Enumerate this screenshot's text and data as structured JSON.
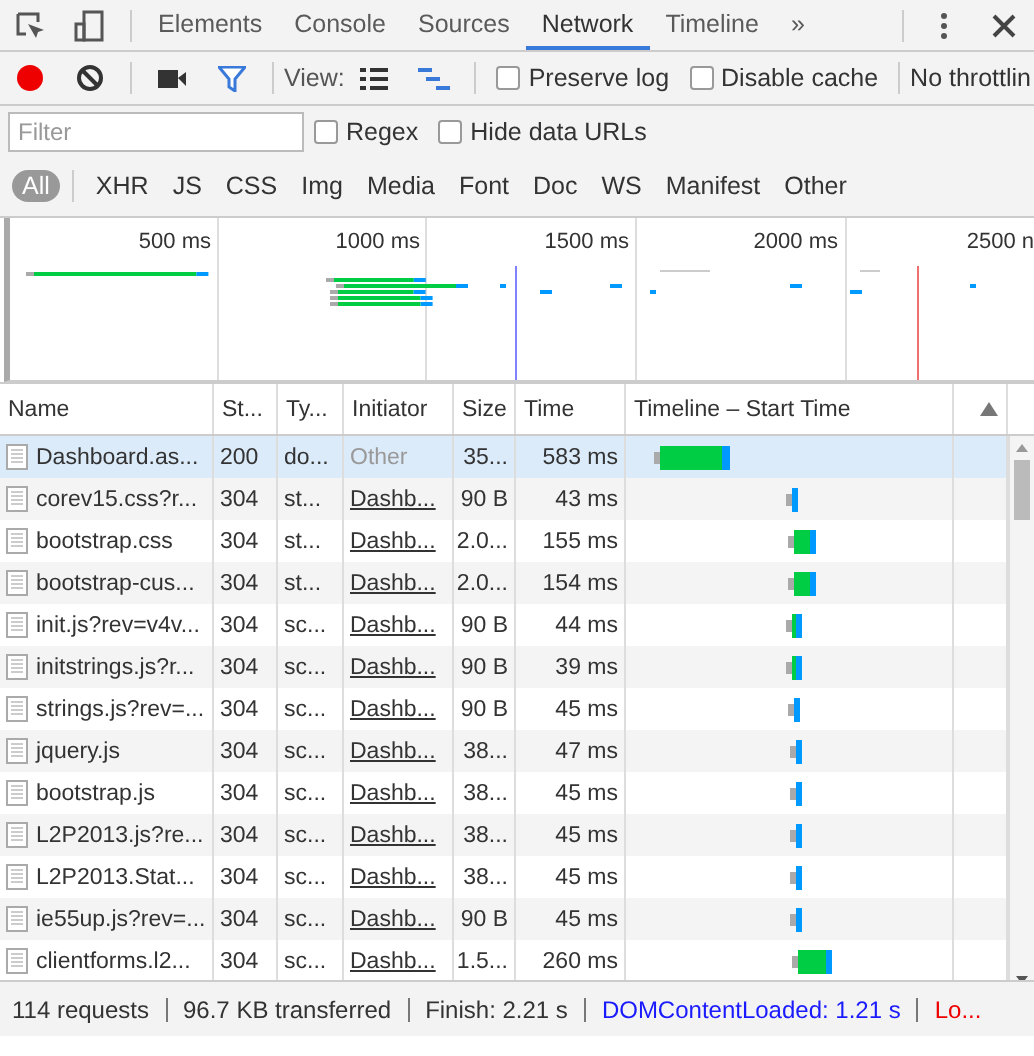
{
  "panel_tabs": [
    {
      "label": "Elements",
      "selected": false
    },
    {
      "label": "Console",
      "selected": false
    },
    {
      "label": "Sources",
      "selected": false
    },
    {
      "label": "Network",
      "selected": true
    },
    {
      "label": "Timeline",
      "selected": false
    }
  ],
  "more_tabs": "»",
  "toolbar": {
    "recording": true,
    "filter_shown": true,
    "view_label": "View:",
    "large_rows": false,
    "overview": true,
    "preserve_log": {
      "label": "Preserve log",
      "checked": false
    },
    "disable_cache": {
      "label": "Disable cache",
      "checked": false
    },
    "throttling": "No throttlin"
  },
  "filter_bar": {
    "placeholder": "Filter",
    "regex": {
      "label": "Regex",
      "checked": false
    },
    "hide_data_urls": {
      "label": "Hide data URLs",
      "checked": false
    }
  },
  "type_filters": [
    {
      "label": "All",
      "selected": true
    },
    {
      "label": "XHR",
      "selected": false
    },
    {
      "label": "JS",
      "selected": false
    },
    {
      "label": "CSS",
      "selected": false
    },
    {
      "label": "Img",
      "selected": false
    },
    {
      "label": "Media",
      "selected": false
    },
    {
      "label": "Font",
      "selected": false
    },
    {
      "label": "Doc",
      "selected": false
    },
    {
      "label": "WS",
      "selected": false
    },
    {
      "label": "Manifest",
      "selected": false
    },
    {
      "label": "Other",
      "selected": false
    }
  ],
  "overview": {
    "ticks": [
      "500 ms",
      "1000 ms",
      "1500 ms",
      "2000 ms",
      "2500 n"
    ]
  },
  "table": {
    "columns": [
      "Name",
      "St...",
      "Ty...",
      "Initiator",
      "Size",
      "Time",
      "Timeline – Start Time"
    ],
    "rows": [
      {
        "name": "Dashboard.as...",
        "status": "200",
        "type": "do...",
        "initiator": "Other",
        "initiator_link": false,
        "size": "35...",
        "time": "583 ms",
        "selected": true
      },
      {
        "name": "corev15.css?r...",
        "status": "304",
        "type": "st...",
        "initiator": "Dashb...",
        "initiator_link": true,
        "size": "90 B",
        "time": "43 ms",
        "selected": false
      },
      {
        "name": "bootstrap.css",
        "status": "304",
        "type": "st...",
        "initiator": "Dashb...",
        "initiator_link": true,
        "size": "2.0...",
        "time": "155 ms",
        "selected": false
      },
      {
        "name": "bootstrap-cus...",
        "status": "304",
        "type": "st...",
        "initiator": "Dashb...",
        "initiator_link": true,
        "size": "2.0...",
        "time": "154 ms",
        "selected": false
      },
      {
        "name": "init.js?rev=v4v...",
        "status": "304",
        "type": "sc...",
        "initiator": "Dashb...",
        "initiator_link": true,
        "size": "90 B",
        "time": "44 ms",
        "selected": false
      },
      {
        "name": "initstrings.js?r...",
        "status": "304",
        "type": "sc...",
        "initiator": "Dashb...",
        "initiator_link": true,
        "size": "90 B",
        "time": "39 ms",
        "selected": false
      },
      {
        "name": "strings.js?rev=...",
        "status": "304",
        "type": "sc...",
        "initiator": "Dashb...",
        "initiator_link": true,
        "size": "90 B",
        "time": "45 ms",
        "selected": false
      },
      {
        "name": "jquery.js",
        "status": "304",
        "type": "sc...",
        "initiator": "Dashb...",
        "initiator_link": true,
        "size": "38...",
        "time": "47 ms",
        "selected": false
      },
      {
        "name": "bootstrap.js",
        "status": "304",
        "type": "sc...",
        "initiator": "Dashb...",
        "initiator_link": true,
        "size": "38...",
        "time": "45 ms",
        "selected": false
      },
      {
        "name": "L2P2013.js?re...",
        "status": "304",
        "type": "sc...",
        "initiator": "Dashb...",
        "initiator_link": true,
        "size": "38...",
        "time": "45 ms",
        "selected": false
      },
      {
        "name": "L2P2013.Stat...",
        "status": "304",
        "type": "sc...",
        "initiator": "Dashb...",
        "initiator_link": true,
        "size": "38...",
        "time": "45 ms",
        "selected": false
      },
      {
        "name": "ie55up.js?rev=...",
        "status": "304",
        "type": "sc...",
        "initiator": "Dashb...",
        "initiator_link": true,
        "size": "90 B",
        "time": "45 ms",
        "selected": false
      },
      {
        "name": "clientforms.l2...",
        "status": "304",
        "type": "sc...",
        "initiator": "Dashb...",
        "initiator_link": true,
        "size": "1.5...",
        "time": "260 ms",
        "selected": false
      }
    ]
  },
  "status_bar": [
    {
      "text": "114 requests",
      "kind": "plain"
    },
    {
      "text": "96.7 KB transferred",
      "kind": "plain"
    },
    {
      "text": "Finish: 2.21 s",
      "kind": "plain"
    },
    {
      "text": "DOMContentLoaded: 1.21 s",
      "kind": "dom"
    },
    {
      "text": "Lo...",
      "kind": "load"
    }
  ]
}
